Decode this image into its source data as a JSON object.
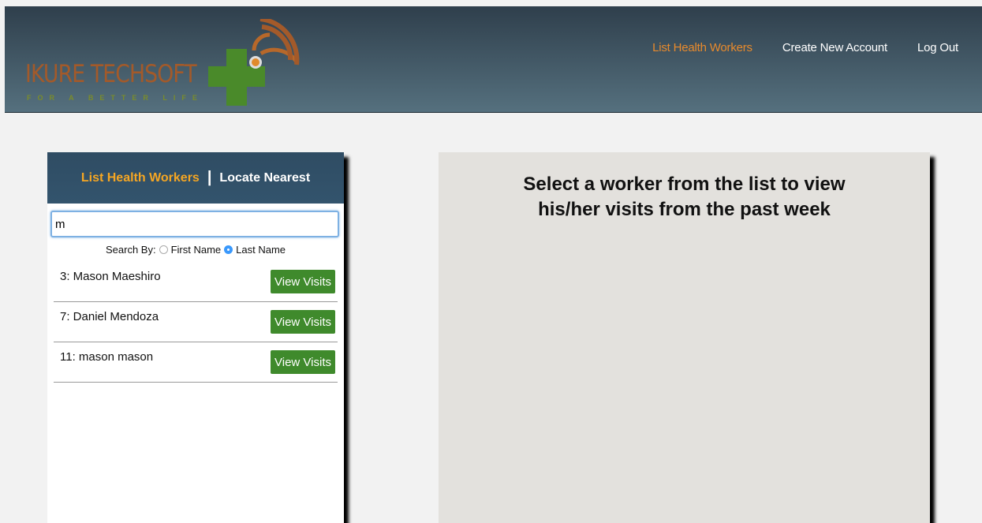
{
  "header": {
    "logo": {
      "brand": "IKURE TECHSOFT",
      "tagline": "FOR A BETTER LIFE"
    },
    "nav": [
      {
        "label": "List Health Workers",
        "active": true
      },
      {
        "label": "Create New Account",
        "active": false
      },
      {
        "label": "Log Out",
        "active": false
      }
    ]
  },
  "left_panel": {
    "tabs": [
      {
        "label": "List Health Workers",
        "active": true
      },
      {
        "label": "Locate Nearest",
        "active": false
      }
    ],
    "separator": "|",
    "search": {
      "value": "m",
      "placeholder": ""
    },
    "search_by": {
      "label": "Search By:",
      "options": [
        {
          "label": "First Name",
          "selected": false
        },
        {
          "label": "Last Name",
          "selected": true
        }
      ]
    },
    "workers": [
      {
        "label": "3: Mason Maeshiro",
        "button": "View Visits"
      },
      {
        "label": "7: Daniel Mendoza",
        "button": "View Visits"
      },
      {
        "label": "11: mason mason",
        "button": "View Visits"
      }
    ]
  },
  "right_panel": {
    "message_line1": "Select a worker from the list to view",
    "message_line2": "his/her visits from the past week"
  },
  "colors": {
    "header_bg_top": "#2f3f4c",
    "header_bg_bottom": "#55707e",
    "nav_active": "#e88a2c",
    "tab_active": "#f5a623",
    "button_green": "#3f8a2c",
    "logo_brand": "#a35a2a",
    "logo_cross": "#4a8a2a"
  }
}
